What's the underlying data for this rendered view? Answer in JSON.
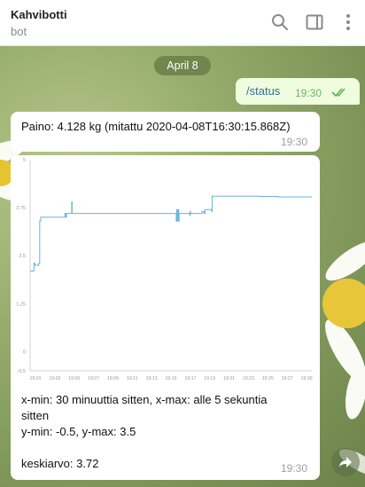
{
  "header": {
    "title": "Kahvibotti",
    "subtitle": "bot"
  },
  "date_chip": "April 8",
  "messages": {
    "outgoing": {
      "text": "/status",
      "time": "19:30"
    },
    "weight": {
      "text": "Paino: 4.128 kg (mitattu 2020-04-08T16:30:15.868Z)",
      "time": "19:30"
    },
    "stats": {
      "line1": "x-min: 30 minuuttia sitten, x-max: alle 5 sekuntia",
      "line2": "sitten",
      "line3": "y-min: -0.5, y-max: 3.5",
      "line4": "keskiarvo: 3.72",
      "time": "19:30"
    }
  },
  "icons": {
    "search": "search-icon",
    "sidebar": "sidebar-toggle-icon",
    "menu": "more-vert-icon",
    "forward": "forward-icon",
    "read": "double-check-icon"
  },
  "colors": {
    "accent": "#4ea4f6",
    "line": "#6bb0e0",
    "bubble_out": "#effdde",
    "time_out": "#6fb26e"
  },
  "chart_data": {
    "type": "line",
    "x_ticks": [
      "19:01",
      "19:03",
      "19:05",
      "19:07",
      "19:09",
      "19:11",
      "19:13",
      "19:15",
      "19:17",
      "19:19",
      "19:21",
      "19:23",
      "19:25",
      "19:27",
      "19:30"
    ],
    "y_ticks": [
      "5",
      "3.75",
      "2.5",
      "1.25",
      "0",
      "-0.5"
    ],
    "ylim": [
      -0.5,
      5
    ],
    "x_minutes": [
      0,
      0.3,
      0.4,
      0.45,
      0.5,
      0.9,
      1.0,
      1.1,
      1.5,
      2.0,
      2.5,
      3.0,
      3.5,
      3.6,
      3.65,
      3.7,
      3.75,
      3.8,
      3.9,
      4.0,
      4.1,
      4.2,
      4.3,
      4.35,
      4.4,
      4.45,
      5.0,
      6.0,
      8.0,
      10.0,
      12.0,
      14.0,
      15.2,
      15.3,
      15.35,
      15.4,
      15.5,
      15.55,
      15.6,
      15.7,
      16.5,
      16.7,
      16.75,
      16.8,
      17.5,
      18.0,
      18.2,
      18.3,
      18.5,
      18.9,
      19.0,
      19.05,
      19.5,
      20.0,
      22.0,
      24.0,
      26.0,
      28.0,
      29.5
    ],
    "y_values": [
      2.1,
      2.1,
      2.3,
      2.3,
      2.25,
      2.3,
      3.4,
      3.5,
      3.5,
      3.5,
      3.5,
      3.5,
      3.5,
      3.5,
      3.6,
      3.6,
      3.5,
      3.6,
      3.6,
      3.6,
      3.6,
      3.6,
      3.6,
      3.9,
      3.6,
      3.6,
      3.6,
      3.6,
      3.6,
      3.6,
      3.6,
      3.6,
      3.6,
      3.4,
      3.7,
      3.4,
      3.7,
      3.4,
      3.6,
      3.6,
      3.6,
      3.55,
      3.65,
      3.6,
      3.6,
      3.65,
      3.6,
      3.7,
      3.7,
      3.7,
      3.65,
      4.05,
      4.05,
      4.05,
      4.05,
      4.04,
      4.03,
      4.03,
      4.03
    ]
  }
}
